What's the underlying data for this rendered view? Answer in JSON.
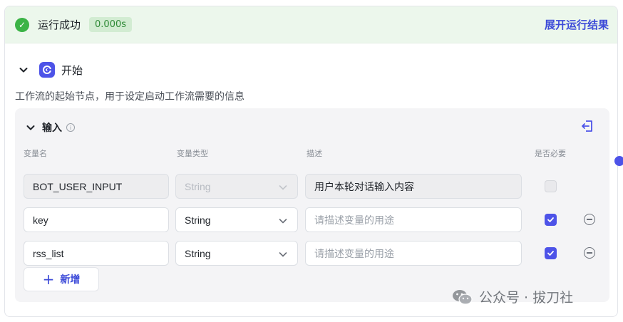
{
  "status": {
    "text": "运行成功",
    "time": "0.000s",
    "expand_label": "展开运行结果"
  },
  "node": {
    "title": "开始",
    "description": "工作流的起始节点，用于设定启动工作流需要的信息"
  },
  "inputs": {
    "title": "输入",
    "columns": [
      "变量名",
      "变量类型",
      "描述",
      "是否必要"
    ],
    "rows": [
      {
        "name": "BOT_USER_INPUT",
        "type": "String",
        "description": "用户本轮对话输入内容",
        "required": false,
        "locked": true
      },
      {
        "name": "key",
        "type": "String",
        "description": "",
        "description_placeholder": "请描述变量的用途",
        "required": true,
        "locked": false
      },
      {
        "name": "rss_list",
        "type": "String",
        "description": "",
        "description_placeholder": "请描述变量的用途",
        "required": true,
        "locked": false
      }
    ],
    "add_label": "新增"
  },
  "watermark": {
    "text": "公众号 · 拔刀社"
  },
  "colors": {
    "accent": "#4d53e8",
    "success": "#3bb346",
    "link": "#3c4ad8"
  }
}
